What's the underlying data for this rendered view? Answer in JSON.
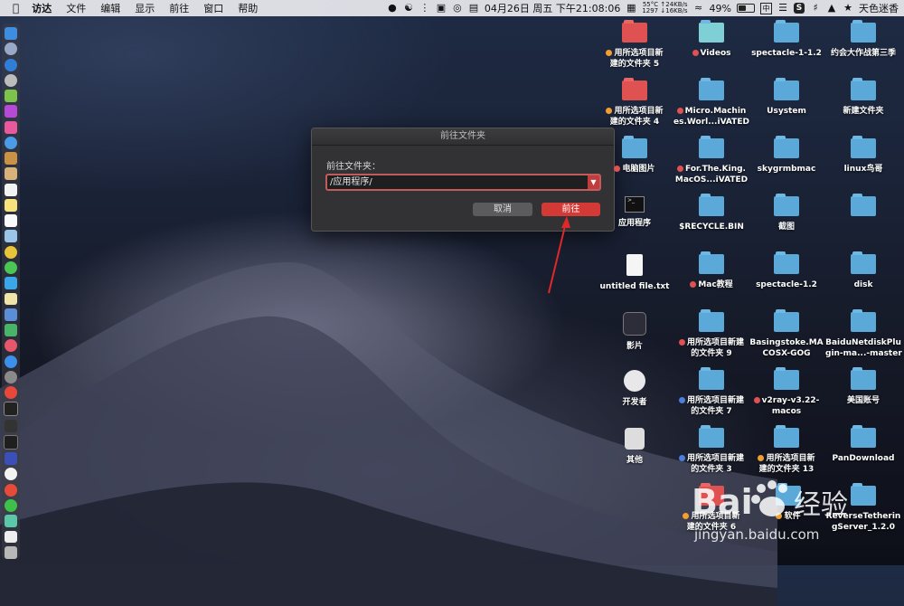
{
  "menubar": {
    "apple": "",
    "items": [
      "访达",
      "文件",
      "编辑",
      "显示",
      "前往",
      "窗口",
      "帮助"
    ],
    "status": {
      "cpu_temp": "55°C",
      "cpu_fan": "1297",
      "net_up": "↑24KB/s",
      "net_down": "↓16KB/s",
      "datetime": "04月26日 周五 下午21:08:06",
      "battery": "49%",
      "input_method": "中",
      "user": "天色迷香"
    }
  },
  "dialog": {
    "title": "前往文件夹",
    "label": "前往文件夹：",
    "path_value": "/应用程序/",
    "cancel_label": "取消",
    "go_label": "前往"
  },
  "desktop": {
    "col1": [
      {
        "label1": "用所选项目新",
        "label2": "建的文件夹 5"
      },
      {
        "label1": "用所选项目新",
        "label2": "建的文件夹 4"
      },
      {
        "label1": "电脑图片",
        "label2": ""
      },
      {
        "label1": "应用程序",
        "label2": ""
      },
      {
        "label1": "untitled file.txt",
        "label2": ""
      },
      {
        "label1": "影片",
        "label2": ""
      },
      {
        "label1": "开发者",
        "label2": ""
      },
      {
        "label1": "其他",
        "label2": ""
      },
      {
        "label1": "用所选项目新",
        "label2": "建的文件夹 6"
      }
    ],
    "col2": [
      {
        "label1": "Videos",
        "label2": ""
      },
      {
        "label1": "Micro.Machin",
        "label2": "es.Worl...iVATED"
      },
      {
        "label1": "For.The.King.",
        "label2": "MacOS...iVATED"
      },
      {
        "label1": "$RECYCLE.BIN",
        "label2": ""
      },
      {
        "label1": "Mac教程",
        "label2": ""
      },
      {
        "label1": "用所选项目新建",
        "label2": "的文件夹 9"
      },
      {
        "label1": "用所选项目新建",
        "label2": "的文件夹 7"
      },
      {
        "label1": "用所选项目新建",
        "label2": "的文件夹 3"
      },
      {
        "label1": "软件",
        "label2": ""
      }
    ],
    "col3": [
      {
        "label1": "spectacle-1-1.2",
        "label2": ""
      },
      {
        "label1": "Usystem",
        "label2": ""
      },
      {
        "label1": "skygrmbmac",
        "label2": ""
      },
      {
        "label1": "截图",
        "label2": ""
      },
      {
        "label1": "spectacle-1.2",
        "label2": ""
      },
      {
        "label1": "Basingstoke.MA",
        "label2": "COSX-GOG"
      },
      {
        "label1": "v2ray-v3.22-",
        "label2": "macos"
      },
      {
        "label1": "用所选项目新",
        "label2": "建的文件夹 13"
      }
    ],
    "col4": [
      {
        "label1": "约会大作战第三季",
        "label2": ""
      },
      {
        "label1": "新建文件夹",
        "label2": ""
      },
      {
        "label1": "linux鸟哥",
        "label2": ""
      },
      {
        "label1": "",
        "label2": ""
      },
      {
        "label1": "disk",
        "label2": ""
      },
      {
        "label1": "BaiduNetdiskPlu",
        "label2": "gin-ma...-master"
      },
      {
        "label1": "美国账号",
        "label2": ""
      },
      {
        "label1": "PanDownload",
        "label2": ""
      },
      {
        "label1": "ReverseTetherin",
        "label2": "gServer_1.2.0"
      }
    ]
  },
  "watermark": {
    "brand": "Bai",
    "brand2": "经验",
    "url": "jingyan.baidu.com"
  },
  "colors": {
    "accent_red": "#d43a35",
    "folder_blue": "#5aa9d8",
    "tag_red": "#e05151",
    "tag_orange": "#f0a030",
    "tag_blue": "#4a7fe0"
  }
}
